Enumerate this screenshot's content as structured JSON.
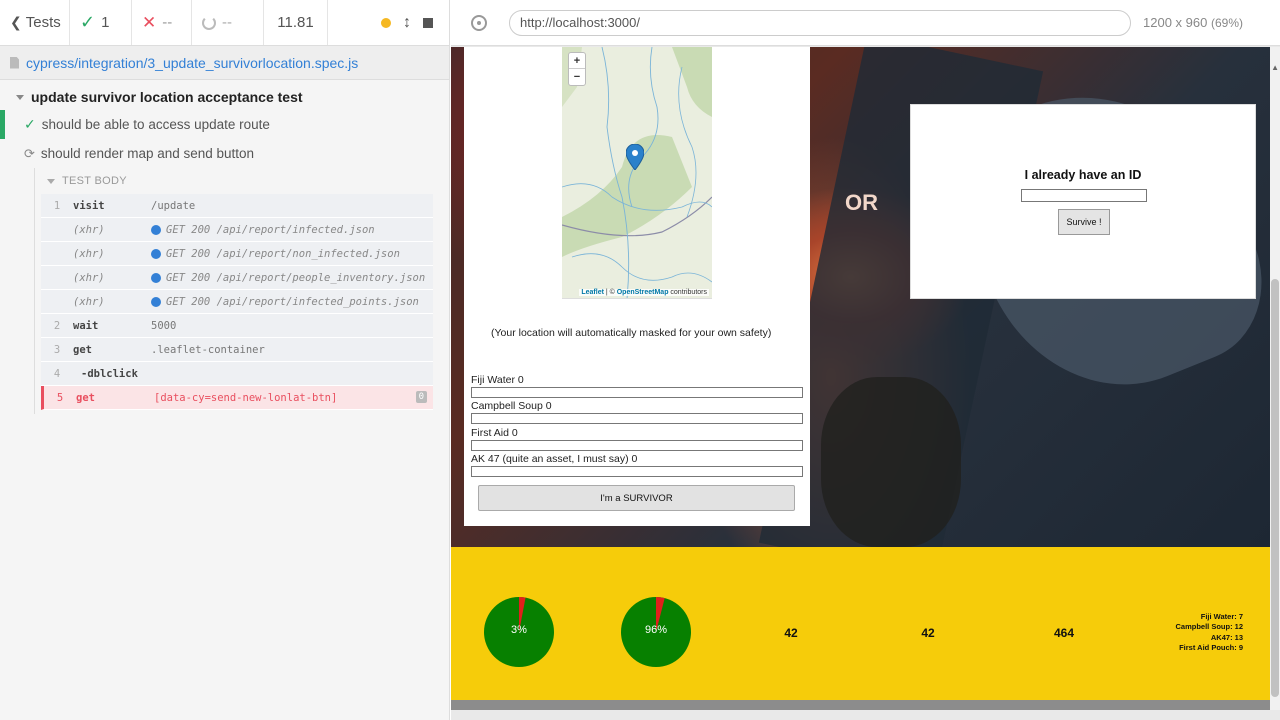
{
  "reporter": {
    "back_label": "Tests",
    "passed_count": "1",
    "failed_count": "--",
    "pending_count": "--",
    "duration": "11.81",
    "spec_path": "cypress/integration/3_update_survivorlocation.spec.js",
    "suite_title": "update survivor location acceptance test",
    "tests": [
      {
        "title": "should be able to access update route",
        "state": "passed"
      },
      {
        "title": "should render map and send button",
        "state": "running"
      }
    ],
    "test_body_label": "TEST BODY",
    "commands": [
      {
        "num": "1",
        "name": "visit",
        "message": "/update"
      },
      {
        "num": "",
        "name": "(xhr)",
        "message": "GET 200 /api/report/infected.json"
      },
      {
        "num": "",
        "name": "(xhr)",
        "message": "GET 200 /api/report/non_infected.json"
      },
      {
        "num": "",
        "name": "(xhr)",
        "message": "GET 200 /api/report/people_inventory.json"
      },
      {
        "num": "",
        "name": "(xhr)",
        "message": "GET 200 /api/report/infected_points.json"
      },
      {
        "num": "2",
        "name": "wait",
        "message": "5000"
      },
      {
        "num": "3",
        "name": "get",
        "message": ".leaflet-container"
      },
      {
        "num": "4",
        "name": "-dblclick",
        "message": ""
      },
      {
        "num": "5",
        "name": "get",
        "message": "[data-cy=send-new-lonlat-btn]",
        "badge": "0"
      }
    ]
  },
  "aut": {
    "url": "http://localhost:3000/",
    "viewport": "1200 x 960",
    "zoom": "(69%)"
  },
  "app": {
    "map": {
      "zoom_in": "+",
      "zoom_out": "−",
      "attribution_leaflet": "Leaflet",
      "attribution_sep": " | © ",
      "attribution_osm": "OpenStreetMap",
      "attribution_rest": " contributors"
    },
    "mask_note": "(Your location will automatically masked for your own safety)",
    "inventory": [
      {
        "label": "Fiji Water 0"
      },
      {
        "label": "Campbell Soup 0"
      },
      {
        "label": "First Aid 0"
      },
      {
        "label": "AK 47 (quite an asset, I must say) 0"
      }
    ],
    "survivor_button": "I'm a SURVIVOR",
    "or_text": "OR",
    "id_card": {
      "title": "I already have an ID",
      "button": "Survive !"
    },
    "stats": {
      "infected_pct": 3,
      "infected_label": "3%",
      "non_infected_pct": 96,
      "non_infected_label": "96%",
      "numbers": [
        "42",
        "42",
        "464"
      ],
      "inventory_lines": [
        "Fiji Water: 7",
        "Campbell Soup: 12",
        "AK47: 13",
        "First Aid Pouch: 9"
      ],
      "colors": {
        "pie_green": "#078000",
        "pie_red": "#e0201b",
        "band": "#f6cc0a"
      }
    }
  }
}
